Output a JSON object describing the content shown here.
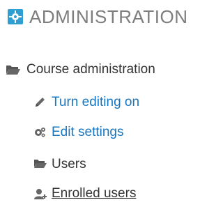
{
  "block": {
    "title": "ADMINISTRATION",
    "title_icon": "gear-puzzle-icon"
  },
  "items": [
    {
      "label": "Course administration",
      "icon": "folder-open-icon",
      "style": "dark"
    },
    {
      "label": "Turn editing on",
      "icon": "pencil-icon",
      "style": "link"
    },
    {
      "label": "Edit settings",
      "icon": "gears-icon",
      "style": "link"
    },
    {
      "label": "Users",
      "icon": "folder-open-icon",
      "style": "dark"
    },
    {
      "label": "Enrolled users",
      "icon": "user-add-icon",
      "style": "link-underlined"
    }
  ],
  "colors": {
    "link": "#1877c1",
    "text": "#333333",
    "header": "#7e7e7e",
    "icon_header": "#2f9fd3",
    "icon_gray": "#666666"
  }
}
